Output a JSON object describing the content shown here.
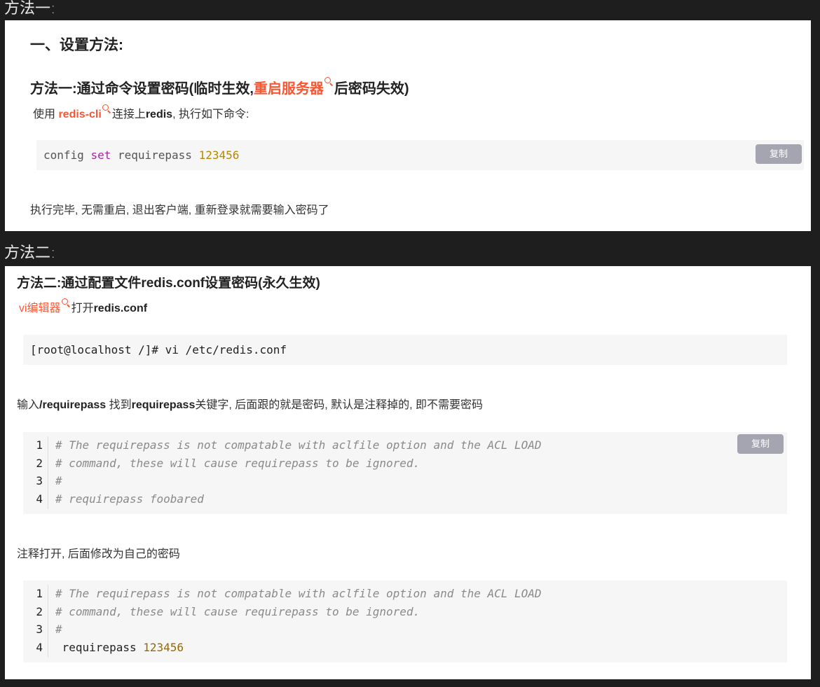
{
  "label1": "方法一:",
  "label2": "方法二:",
  "card1": {
    "heading": "一、设置方法:",
    "subheading_pre": "方法一:通过命令设置密码(临时生效,",
    "subheading_link": "重启服务器",
    "subheading_post": "后密码失效)",
    "intro_pre": "使用 ",
    "intro_link": "redis-cli",
    "intro_mid": "连接上",
    "intro_bold": "redis",
    "intro_post": ", 执行如下命令:",
    "code": {
      "cmd": "config ",
      "kw": "set",
      "arg": " requirepass ",
      "num": "123456"
    },
    "copy_label": "复制",
    "after_text": "执行完毕, 无需重启, 退出客户端, 重新登录就需要输入密码了"
  },
  "card2": {
    "heading": "方法二:通过配置文件redis.conf设置密码(永久生效)",
    "open_link": "vi编辑器",
    "open_mid": "打开",
    "open_bold": "redis.conf",
    "shell_cmd": "[root@localhost /]# vi /etc/redis.conf",
    "find_pre": "输入",
    "find_bold1": "/requirepass",
    "find_mid": " 找到",
    "find_bold2": "requirepass",
    "find_post": "关键字, 后面跟的就是密码, 默认是注释掉的, 即不需要密码",
    "copy_label": "复制",
    "block1": {
      "line_numbers": [
        "1",
        "2",
        "3",
        "4"
      ],
      "lines": [
        "# The requirepass is not compatable with aclfile option and the ACL LOAD",
        "# command, these will cause requirepass to be ignored.",
        "#",
        "# requirepass foobared"
      ]
    },
    "uncomment_text": "注释打开, 后面修改为自己的密码",
    "block2": {
      "line_numbers": [
        "1",
        "2",
        "3",
        "4"
      ],
      "lines": [
        "# The requirepass is not compatable with aclfile option and the ACL LOAD",
        "# command, these will cause requirepass to be ignored.",
        "#"
      ],
      "last_key": " requirepass ",
      "last_value": "123456"
    }
  }
}
